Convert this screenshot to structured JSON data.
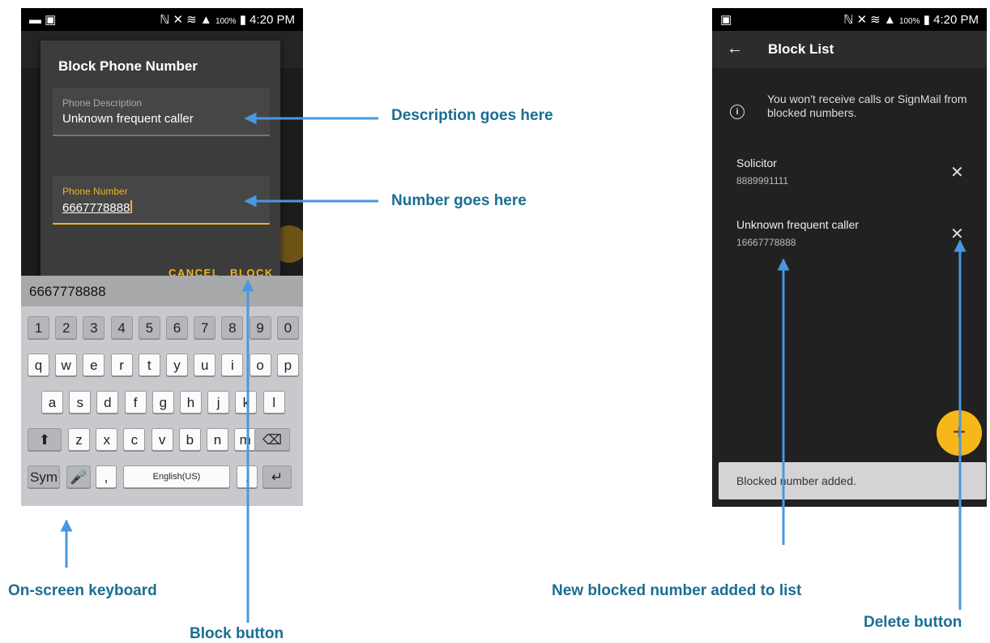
{
  "status_bar": {
    "left_phone_icons": "▬ ▣",
    "right_phone_icons": "▣",
    "signal_icons": "ℕ ✕ ≋ ▲",
    "battery_pct": "100%",
    "time": "4:20 PM"
  },
  "dialog": {
    "title": "Block Phone Number",
    "description_label": "Phone Description",
    "description_value": "Unknown frequent  caller",
    "number_label": "Phone Number",
    "number_value": "6667778888",
    "cancel_label": "CANCEL",
    "block_label": "BLOCK"
  },
  "keyboard": {
    "suggestion": "6667778888",
    "row_numbers": [
      "1",
      "2",
      "3",
      "4",
      "5",
      "6",
      "7",
      "8",
      "9",
      "0"
    ],
    "row_q": [
      "q",
      "w",
      "e",
      "r",
      "t",
      "y",
      "u",
      "i",
      "o",
      "p"
    ],
    "row_a": [
      "a",
      "s",
      "d",
      "f",
      "g",
      "h",
      "j",
      "k",
      "l"
    ],
    "row_z": [
      "z",
      "x",
      "c",
      "v",
      "b",
      "n",
      "m"
    ],
    "sym_label": "Sym",
    "comma_label": ",",
    "space_label": "English(US)",
    "period_label": "."
  },
  "block_list": {
    "title": "Block List",
    "info_text": "You won't receive calls or SignMail from blocked numbers.",
    "items": [
      {
        "name": "Solicitor",
        "number": "8889991111"
      },
      {
        "name": "Unknown frequent  caller",
        "number": "16667778888"
      }
    ],
    "fab_label": "+",
    "snackbar": "Blocked number added."
  },
  "callouts": {
    "description": "Description goes here",
    "number": "Number goes here",
    "keyboard": "On-screen keyboard",
    "block_button": "Block button",
    "new_number": "New blocked number added to list",
    "delete_button": "Delete button"
  },
  "colors": {
    "accent": "#f0b41e",
    "callout_text": "#1a6e93",
    "arrow": "#4a97e0"
  }
}
